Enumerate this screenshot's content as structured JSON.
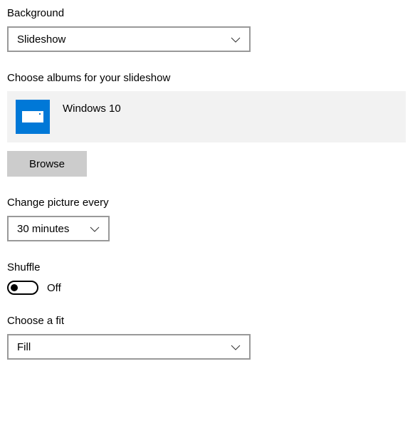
{
  "background": {
    "label": "Background",
    "value": "Slideshow"
  },
  "albums": {
    "label": "Choose albums for your slideshow",
    "selected": "Windows 10",
    "browse_label": "Browse"
  },
  "interval": {
    "label": "Change picture every",
    "value": "30 minutes"
  },
  "shuffle": {
    "label": "Shuffle",
    "state_label": "Off"
  },
  "fit": {
    "label": "Choose a fit",
    "value": "Fill"
  }
}
